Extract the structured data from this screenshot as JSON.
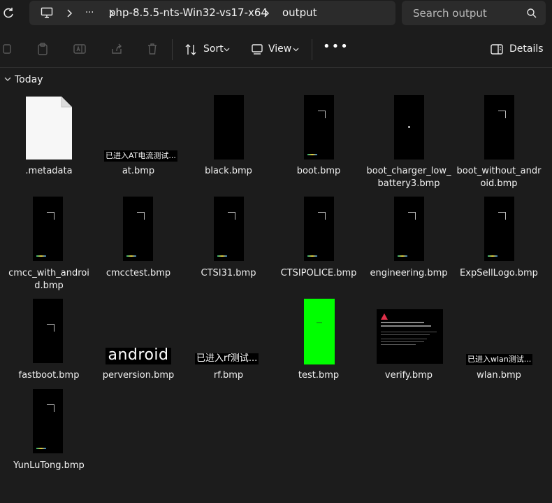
{
  "address_bar": {
    "more_label": "···",
    "crumbs": [
      "php-8.5.5-nts-Win32-vs17-x64",
      "output"
    ]
  },
  "search": {
    "placeholder": "Search output"
  },
  "toolbar": {
    "sort_label": "Sort",
    "view_label": "View",
    "more_label": "•••",
    "details_label": "Details"
  },
  "group": {
    "label": "Today"
  },
  "files": [
    {
      "name": ".metadata",
      "thumb": "blank-document"
    },
    {
      "name": "at.bmp",
      "thumb": "text",
      "thumb_text": "已进入AT电流测试..."
    },
    {
      "name": "black.bmp",
      "thumb": "black"
    },
    {
      "name": "boot.bmp",
      "thumb": "phone-logo"
    },
    {
      "name": "boot_charger_low_battery3.bmp",
      "thumb": "phone-dot"
    },
    {
      "name": "boot_without_android.bmp",
      "thumb": "phone-logo"
    },
    {
      "name": "cmcc_with_android.bmp",
      "thumb": "phone-logo"
    },
    {
      "name": "cmcctest.bmp",
      "thumb": "phone-logo"
    },
    {
      "name": "CTSI31.bmp",
      "thumb": "phone-logo"
    },
    {
      "name": "CTSIPOLICE.bmp",
      "thumb": "phone-logo"
    },
    {
      "name": "engineering.bmp",
      "thumb": "phone-logo"
    },
    {
      "name": "ExpSellLogo.bmp",
      "thumb": "phone-logo"
    },
    {
      "name": "fastboot.bmp",
      "thumb": "phone-logo"
    },
    {
      "name": "perversion.bmp",
      "thumb": "android-wordmark",
      "thumb_text": "android"
    },
    {
      "name": "rf.bmp",
      "thumb": "text",
      "thumb_text": "已进入rf测试..."
    },
    {
      "name": "test.bmp",
      "thumb": "green"
    },
    {
      "name": "verify.bmp",
      "thumb": "warning-screen"
    },
    {
      "name": "wlan.bmp",
      "thumb": "text",
      "thumb_text": "已进入wlan测试..."
    },
    {
      "name": "YunLuTong.bmp",
      "thumb": "phone-logo"
    }
  ],
  "colors": {
    "background": "#1c1c1c",
    "bar": "#2b2b2b",
    "green_thumb": "#00ff00",
    "warning_red": "#e0304a"
  }
}
